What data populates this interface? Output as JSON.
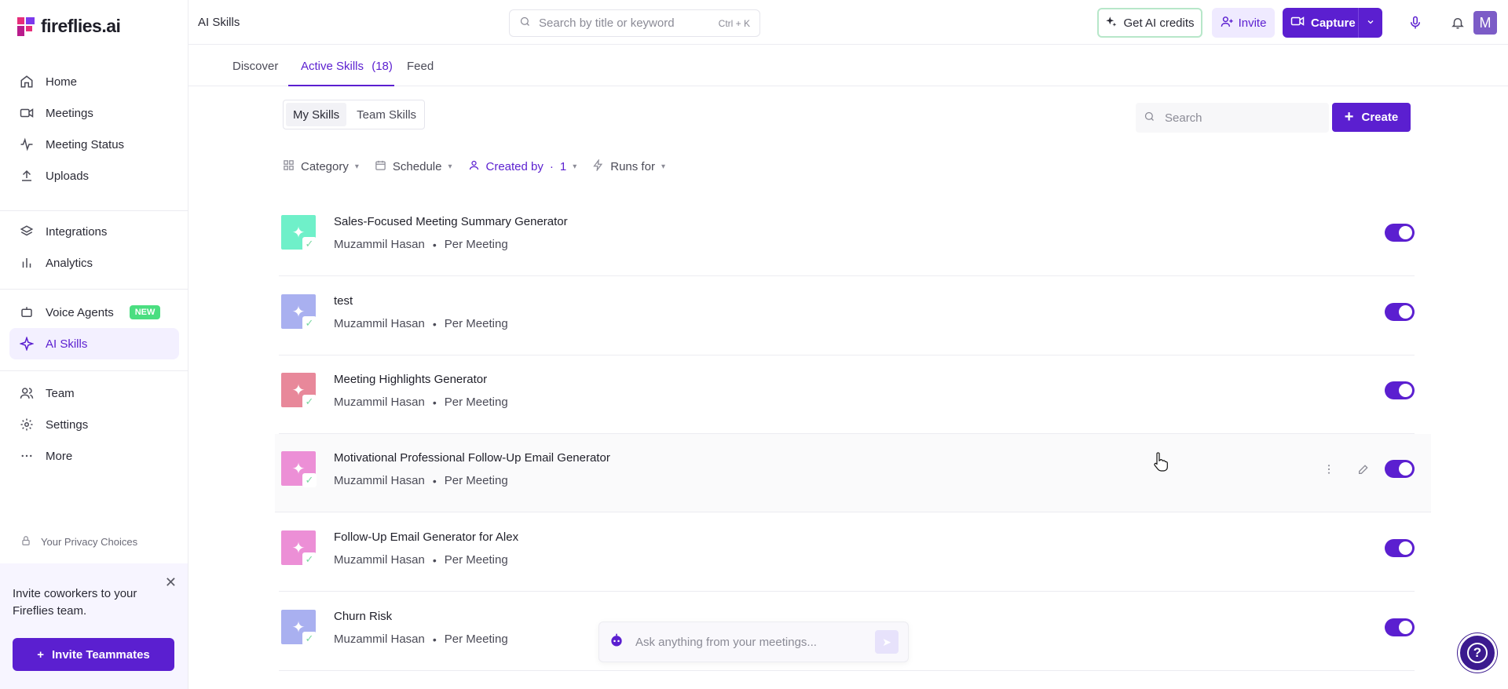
{
  "brand": {
    "name": "fireflies.ai",
    "accent": "#5b1fd0"
  },
  "sidebar": {
    "items": [
      {
        "label": "Home",
        "icon": "home-icon"
      },
      {
        "label": "Meetings",
        "icon": "video-icon"
      },
      {
        "label": "Meeting Status",
        "icon": "activity-icon"
      },
      {
        "label": "Uploads",
        "icon": "upload-icon"
      },
      {
        "label": "Integrations",
        "icon": "layers-icon"
      },
      {
        "label": "Analytics",
        "icon": "bar-chart-icon"
      },
      {
        "label": "Voice Agents",
        "icon": "bot-icon",
        "badge": "NEW"
      },
      {
        "label": "AI Skills",
        "icon": "sparkle-icon",
        "active": true
      },
      {
        "label": "Team",
        "icon": "users-icon"
      },
      {
        "label": "Settings",
        "icon": "gear-icon"
      },
      {
        "label": "More",
        "icon": "more-icon"
      }
    ],
    "privacy": "Your Privacy Choices",
    "invite_card": {
      "text": "Invite coworkers to your Fireflies team.",
      "button": "Invite Teammates"
    }
  },
  "topbar": {
    "crumb": "AI Skills",
    "search_placeholder": "Search by title or keyword",
    "search_shortcut": "Ctrl + K",
    "credits_label": "Get AI credits",
    "invite_label": "Invite",
    "capture_label": "Capture",
    "avatar_initial": "M"
  },
  "tabs": [
    {
      "label": "Discover"
    },
    {
      "label": "Active Skills",
      "count": "(18)",
      "active": true
    },
    {
      "label": "Feed"
    }
  ],
  "segmented": {
    "my": "My Skills",
    "team": "Team Skills",
    "active": "My Skills"
  },
  "skill_search_placeholder": "Search",
  "create_label": "Create",
  "filters": {
    "category": "Category",
    "schedule": "Schedule",
    "created_by": "Created by",
    "created_by_count": "1",
    "runs_for": "Runs for"
  },
  "skills": [
    {
      "title": "Sales-Focused Meeting Summary Generator",
      "author": "Muzammil Hasan",
      "frequency": "Per Meeting",
      "color": "#6ff0c9",
      "enabled": true
    },
    {
      "title": "test",
      "author": "Muzammil Hasan",
      "frequency": "Per Meeting",
      "color": "#a9b0f0",
      "enabled": true
    },
    {
      "title": "Meeting Highlights Generator",
      "author": "Muzammil Hasan",
      "frequency": "Per Meeting",
      "color": "#e8889a",
      "enabled": true
    },
    {
      "title": "Motivational Professional Follow-Up Email Generator",
      "author": "Muzammil Hasan",
      "frequency": "Per Meeting",
      "color": "#ec8fd6",
      "enabled": true
    },
    {
      "title": "Follow-Up Email Generator for Alex",
      "author": "Muzammil Hasan",
      "frequency": "Per Meeting",
      "color": "#ec8fd6",
      "enabled": true
    },
    {
      "title": "Churn Risk",
      "author": "Muzammil Hasan",
      "frequency": "Per Meeting",
      "color": "#a9b0f0",
      "enabled": true
    }
  ],
  "ask_placeholder": "Ask anything from your meetings..."
}
